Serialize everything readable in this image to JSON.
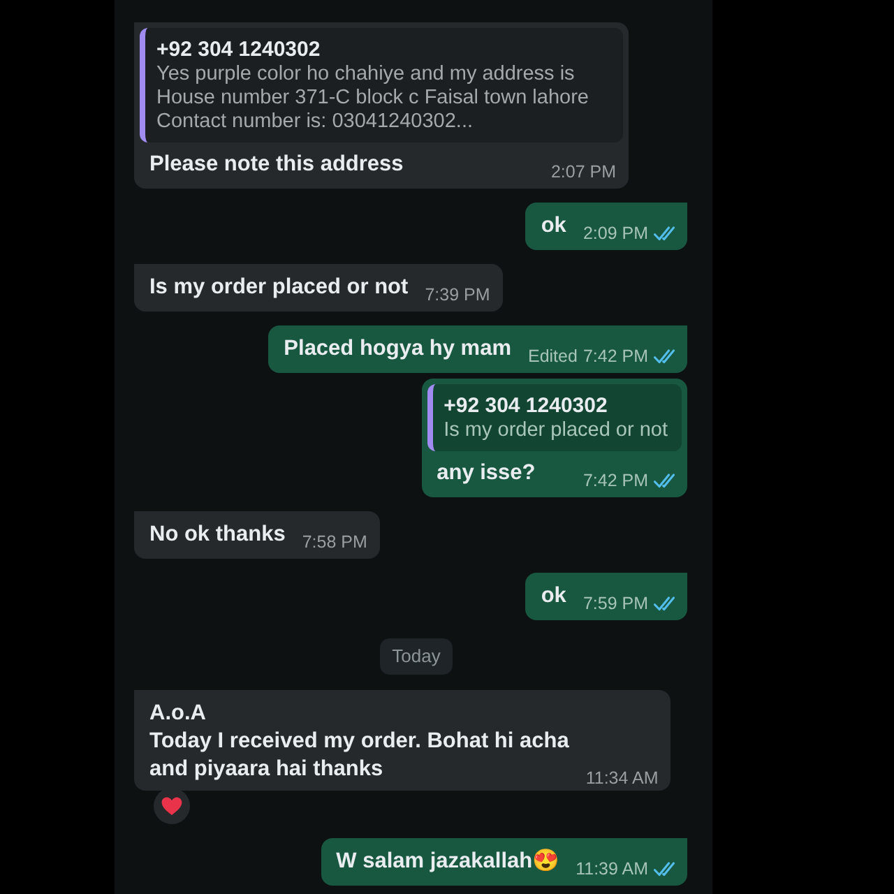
{
  "chat": {
    "messages": [
      {
        "kind": "message",
        "outgoing": false,
        "tail": true,
        "quote": {
          "sender": "+92 304 1240302",
          "text": "Yes purple color ho chahiye and my address is\nHouse number 371-C block c Faisal town lahore\nContact number is: 03041240302..."
        },
        "text": "Please note this address",
        "time": "2:07 PM"
      },
      {
        "kind": "message",
        "outgoing": true,
        "tail": true,
        "text": "ok",
        "time": "2:09 PM",
        "read": true
      },
      {
        "kind": "message",
        "outgoing": false,
        "tail": true,
        "text": "Is my order placed or not",
        "time": "7:39 PM"
      },
      {
        "kind": "message",
        "outgoing": true,
        "tail": true,
        "text": "Placed hogya hy mam",
        "edited_label": "Edited",
        "time": "7:42 PM",
        "read": true
      },
      {
        "kind": "message",
        "outgoing": true,
        "tail": false,
        "quote": {
          "sender": "+92 304 1240302",
          "text": "Is my order placed or not"
        },
        "text": "any isse?",
        "time": "7:42 PM",
        "read": true
      },
      {
        "kind": "message",
        "outgoing": false,
        "tail": true,
        "text": "No ok thanks",
        "time": "7:58 PM"
      },
      {
        "kind": "message",
        "outgoing": true,
        "tail": true,
        "text": "ok",
        "time": "7:59 PM",
        "read": true
      },
      {
        "kind": "date",
        "text": "Today"
      },
      {
        "kind": "message",
        "outgoing": false,
        "tail": true,
        "text": "A.o.A\nToday I received my order. Bohat hi acha\nand piyaara hai thanks",
        "time": "11:34 AM"
      },
      {
        "kind": "reaction",
        "outgoing": false
      },
      {
        "kind": "message",
        "outgoing": true,
        "tail": true,
        "text": "W salam jazakallah😍",
        "time": "11:39 AM",
        "read": true
      }
    ]
  }
}
